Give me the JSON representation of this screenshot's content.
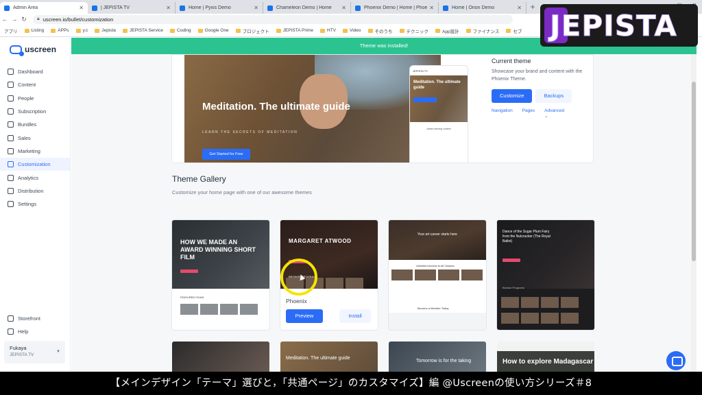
{
  "browser": {
    "tabs": [
      {
        "title": "Admin Area",
        "active": true
      },
      {
        "title": "| JEPISTA TV",
        "active": false
      },
      {
        "title": "Home | Pyxis Demo",
        "active": false
      },
      {
        "title": "Chameleon Demo | Home",
        "active": false
      },
      {
        "title": "Phoenix Demo | Home | Phoenix",
        "active": false
      },
      {
        "title": "Home | Orion Demo",
        "active": false
      }
    ],
    "new_tab": "+",
    "url": "uscreen.io/bullet/customization",
    "bookmarks": [
      "アプリ",
      "Listing",
      "APPs",
      "y.c",
      "Jepista",
      "JEPISTA Service",
      "Coding",
      "Google One",
      "プロジェクト",
      "JEPISTA Prime",
      "HTV",
      "Video",
      "そのうち",
      "テクニック",
      "App設計",
      "ファイナンス",
      "セブ"
    ]
  },
  "overlay_logo": "JEPISTA",
  "app": {
    "brand": "uscreen",
    "nav": [
      {
        "label": "Dashboard",
        "icon": "dashboard-icon"
      },
      {
        "label": "Content",
        "icon": "content-icon"
      },
      {
        "label": "People",
        "icon": "people-icon"
      },
      {
        "label": "Subscription",
        "icon": "subscription-icon"
      },
      {
        "label": "Bundles",
        "icon": "bundles-icon"
      },
      {
        "label": "Sales",
        "icon": "sales-icon"
      },
      {
        "label": "Marketing",
        "icon": "marketing-icon"
      },
      {
        "label": "Customization",
        "icon": "customization-icon",
        "active": true
      },
      {
        "label": "Analytics",
        "icon": "analytics-icon"
      },
      {
        "label": "Distribution",
        "icon": "distribution-icon"
      },
      {
        "label": "Settings",
        "icon": "settings-icon"
      }
    ],
    "nav_bottom": [
      {
        "label": "Storefront",
        "icon": "storefront-icon"
      },
      {
        "label": "Help",
        "icon": "help-icon"
      }
    ],
    "account": {
      "name": "Fukaya",
      "org": "JEPISTA TV"
    }
  },
  "banner": "Theme was installed!",
  "current_theme": {
    "hero_title": "Meditation. The ultimate guide",
    "hero_sub": "LEARN THE SECRETS OF MEDITATION",
    "hero_button": "Get Started for Free",
    "phone_brand": "JEPISTA TV",
    "phone_title": "Meditation. The ultimate guide",
    "phone_body": "Award winning content",
    "title": "Current theme",
    "description": "Showcase your brand and content with the Phoenix Theme.",
    "customize": "Customize",
    "backups": "Backups",
    "links": [
      "Navigation",
      "Pages",
      "Advanced"
    ]
  },
  "gallery": {
    "title": "Theme Gallery",
    "subtitle": "Customize your home page with one of our awesome themes",
    "cards": [
      {
        "headline": "HOW WE MADE AN AWARD WINNING SHORT FILM",
        "caption": "FEATURED FILMS"
      },
      {
        "headline": "MARGARET ATWOOD",
        "caption": "BROWSE PROGRAMS",
        "name": "Phoenix",
        "preview": "Preview",
        "install": "Install"
      },
      {
        "headline": "Your art career starts here",
        "caption": "Unlimited Access to All Classes",
        "caption2": "Become a Member Today"
      },
      {
        "headline": "Dance of the Sugar Plum Fairy from the Nutcracker (The Royal Ballet)",
        "caption": "Browse Programs"
      }
    ],
    "row2": [
      {
        "headline": ""
      },
      {
        "headline": "Meditation. The ultimate guide"
      },
      {
        "headline": "Tomorrow is for the taking"
      },
      {
        "headline": "How to explore Madagascar"
      }
    ]
  },
  "subtitle": "【メインデザイン「テーマ」選びと，「共通ページ」のカスタマイズ】編 @Uscreenの使い方シリーズ＃8"
}
